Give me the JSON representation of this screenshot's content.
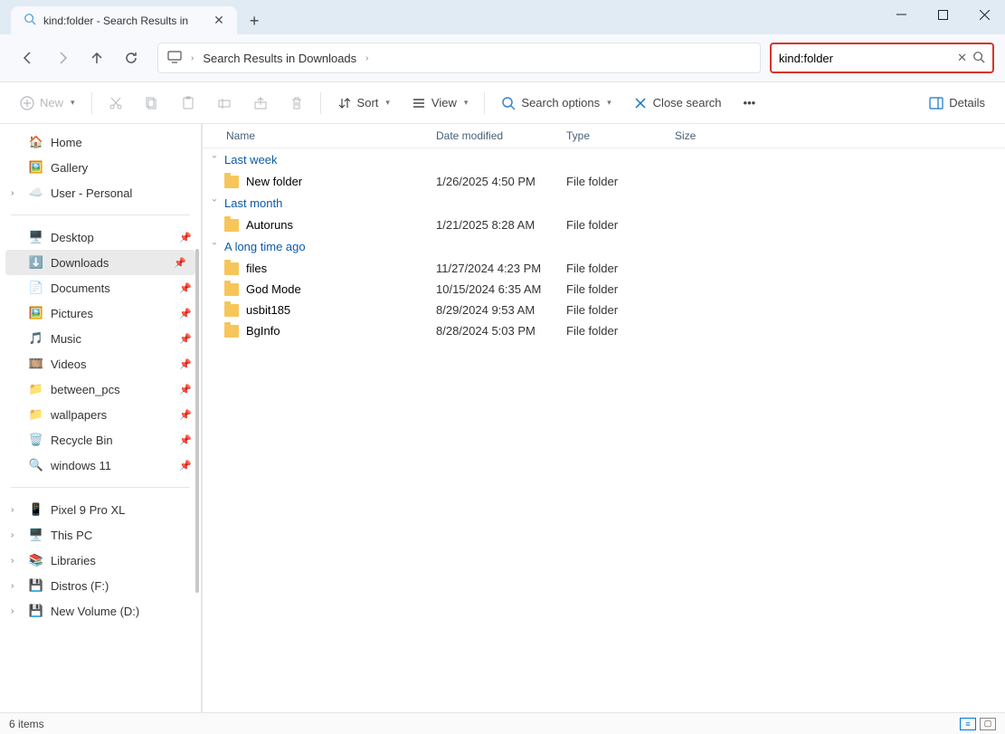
{
  "window": {
    "tab_title": "kind:folder - Search Results in",
    "addr_text": "Search Results in Downloads",
    "search_value": "kind:folder"
  },
  "toolbar": {
    "new": "New",
    "sort": "Sort",
    "view": "View",
    "search_options": "Search options",
    "close_search": "Close search",
    "details": "Details"
  },
  "sidebar": {
    "home": "Home",
    "gallery": "Gallery",
    "user": "User - Personal",
    "quick": [
      {
        "label": "Desktop",
        "icon": "desktop"
      },
      {
        "label": "Downloads",
        "icon": "downloads",
        "selected": true
      },
      {
        "label": "Documents",
        "icon": "documents"
      },
      {
        "label": "Pictures",
        "icon": "pictures"
      },
      {
        "label": "Music",
        "icon": "music"
      },
      {
        "label": "Videos",
        "icon": "videos"
      },
      {
        "label": "between_pcs",
        "icon": "folder"
      },
      {
        "label": "wallpapers",
        "icon": "folder"
      },
      {
        "label": "Recycle Bin",
        "icon": "recycle"
      },
      {
        "label": "windows 11",
        "icon": "search"
      }
    ],
    "devices": [
      "Pixel 9 Pro XL",
      "This PC",
      "Libraries",
      "Distros (F:)",
      "New Volume (D:)"
    ]
  },
  "columns": {
    "name": "Name",
    "date": "Date modified",
    "type": "Type",
    "size": "Size"
  },
  "groups": [
    {
      "label": "Last week",
      "items": [
        {
          "name": "New folder",
          "date": "1/26/2025 4:50 PM",
          "type": "File folder"
        }
      ]
    },
    {
      "label": "Last month",
      "items": [
        {
          "name": "Autoruns",
          "date": "1/21/2025 8:28 AM",
          "type": "File folder"
        }
      ]
    },
    {
      "label": "A long time ago",
      "items": [
        {
          "name": "files",
          "date": "11/27/2024 4:23 PM",
          "type": "File folder"
        },
        {
          "name": "God Mode",
          "date": "10/15/2024 6:35 AM",
          "type": "File folder"
        },
        {
          "name": "usbit185",
          "date": "8/29/2024 9:53 AM",
          "type": "File folder"
        },
        {
          "name": "BgInfo",
          "date": "8/28/2024 5:03 PM",
          "type": "File folder"
        }
      ]
    }
  ],
  "status": {
    "count": "6 items"
  }
}
